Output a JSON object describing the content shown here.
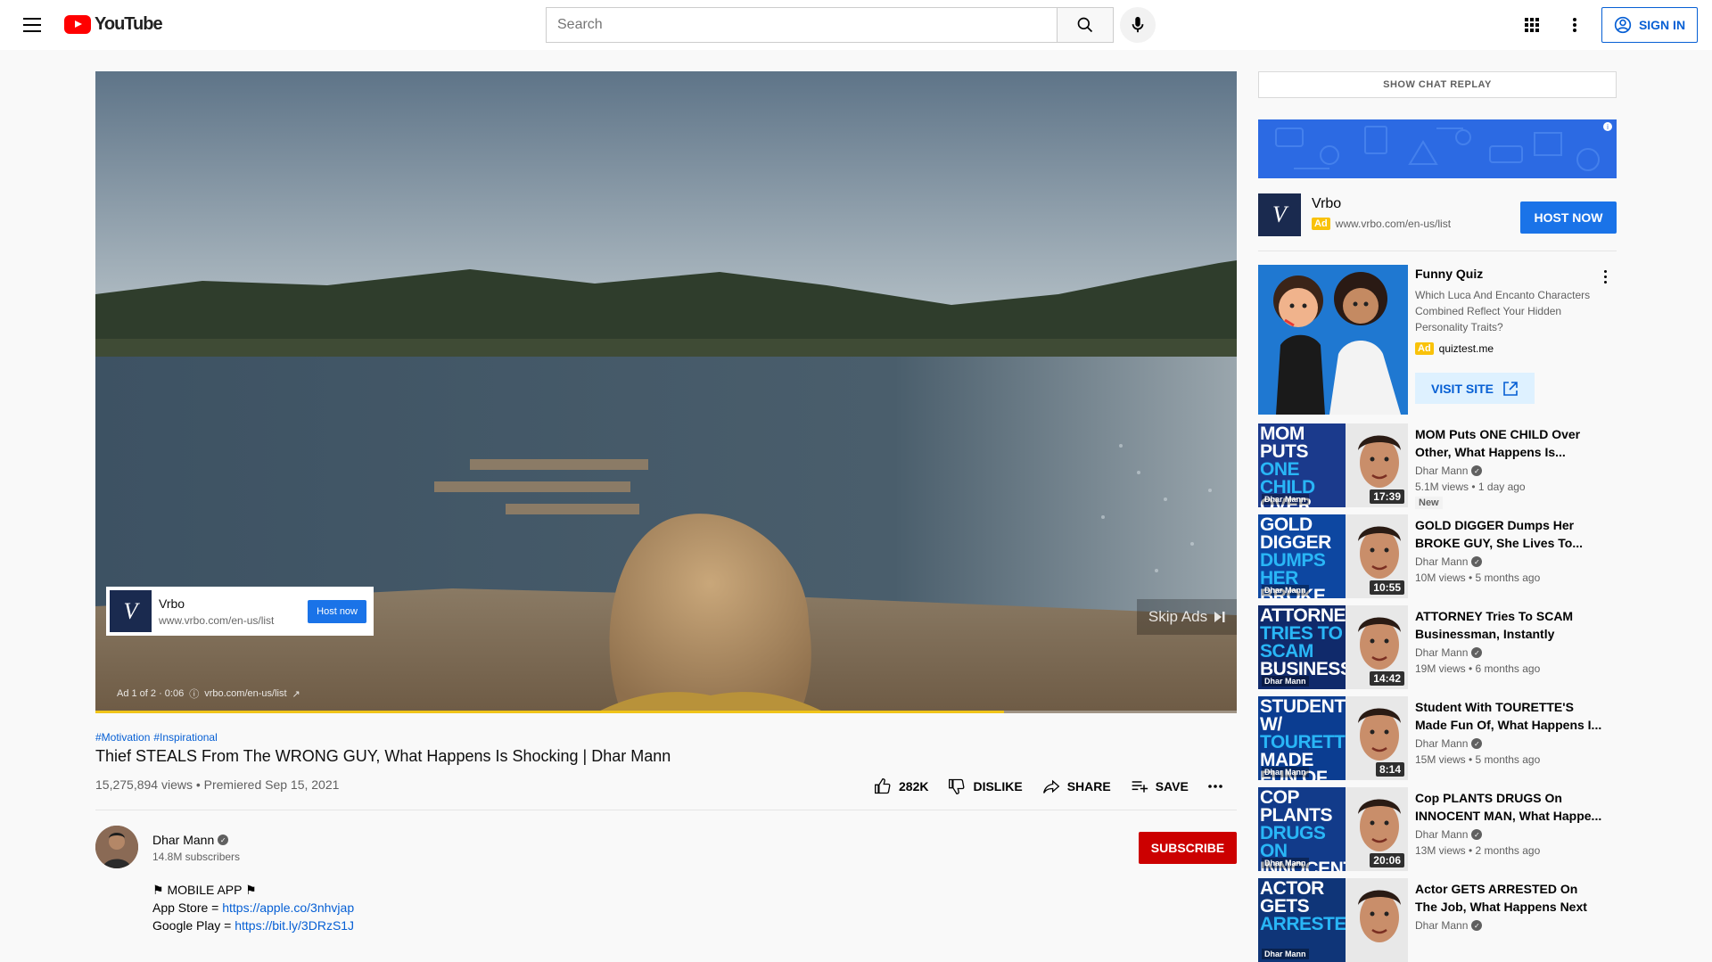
{
  "header": {
    "logo_text": "YouTube",
    "search_placeholder": "Search",
    "signin_label": "SIGN IN"
  },
  "player": {
    "progress": 0.796,
    "ad_card": {
      "name": "Vrbo",
      "url": "www.vrbo.com/en-us/list",
      "button": "Host now",
      "logo_letter": "V"
    },
    "skip_label": "Skip Ads",
    "ad_info": {
      "position": "Ad 1 of 2 · 0:06",
      "link": "vrbo.com/en-us/list"
    }
  },
  "video": {
    "tags": [
      "#Motivation",
      "#Inspirational"
    ],
    "title": "Thief STEALS From The WRONG GUY, What Happens Is Shocking | Dhar Mann",
    "views_line": "15,275,894 views • Premiered Sep 15, 2021",
    "likes": "282K",
    "dislike_label": "DISLIKE",
    "share_label": "SHARE",
    "save_label": "SAVE",
    "channel": {
      "name": "Dhar Mann",
      "subscribers": "14.8M subscribers"
    },
    "subscribe_label": "SUBSCRIBE",
    "description": {
      "line1": "⚑ MOBILE APP ⚑",
      "appstore_label": "App Store = ",
      "appstore_link": "https://apple.co/3nhvjap",
      "googleplay_label": "Google Play = ",
      "googleplay_link": "https://bit.ly/3DRzS1J"
    }
  },
  "sidebar": {
    "chat_replay_label": "SHOW CHAT REPLAY",
    "vrbo_ad": {
      "name": "Vrbo",
      "badge": "Ad",
      "url": "www.vrbo.com/en-us/list",
      "button": "HOST NOW",
      "logo_letter": "V"
    },
    "quiz_ad": {
      "title": "Funny Quiz",
      "description": "Which Luca And Encanto Characters Combined Reflect Your Hidden Personality Traits?",
      "badge": "Ad",
      "domain": "quiztest.me",
      "button": "VISIT SITE"
    },
    "recommendations": [
      {
        "thumb_lines": [
          "MOM PUTS",
          "ONE CHILD",
          "OVER OTHER"
        ],
        "thumb_color": "#1b3a8c",
        "accent": "#29b6f6",
        "brand": "Dhar Mann",
        "duration": "17:39",
        "title": "MOM Puts ONE CHILD Over Other, What Happens Is...",
        "channel": "Dhar Mann",
        "stats": "5.1M views • 1 day ago",
        "badge": "New"
      },
      {
        "thumb_lines": [
          "GOLD DIGGER",
          "DUMPS HER",
          "BROKE GUY"
        ],
        "thumb_color": "#0d47a1",
        "accent": "#29b6f6",
        "brand": "Dhar Mann",
        "duration": "10:55",
        "title": "GOLD DIGGER Dumps Her BROKE GUY, She Lives To...",
        "channel": "Dhar Mann",
        "stats": "10M views • 5 months ago"
      },
      {
        "thumb_lines": [
          "ATTORNEY",
          "TRIES TO SCAM",
          "BUSINESSMAN"
        ],
        "thumb_color": "#102a6b",
        "accent": "#29b6f6",
        "brand": "Dhar Mann",
        "duration": "14:42",
        "title": "ATTORNEY Tries To SCAM Businessman, Instantly Regret...",
        "channel": "Dhar Mann",
        "stats": "19M views • 6 months ago"
      },
      {
        "thumb_lines": [
          "STUDENT W/",
          "TOURETTE'S",
          "MADE FUN OF"
        ],
        "thumb_color": "#0b3d91",
        "accent": "#29b6f6",
        "brand": "Dhar Mann",
        "duration": "8:14",
        "title": "Student With TOURETTE'S Made Fun Of, What Happens I...",
        "channel": "Dhar Mann",
        "stats": "15M views • 5 months ago"
      },
      {
        "thumb_lines": [
          "COP PLANTS",
          "DRUGS ON",
          "INNOCENT MAN"
        ],
        "thumb_color": "#123b8a",
        "accent": "#29b6f6",
        "brand": "Dhar Mann",
        "duration": "20:06",
        "title": "Cop PLANTS DRUGS On INNOCENT MAN, What Happe...",
        "channel": "Dhar Mann",
        "stats": "13M views • 2 months ago"
      },
      {
        "thumb_lines": [
          "ACTOR GETS",
          "ARRESTED",
          ""
        ],
        "thumb_color": "#0f3578",
        "accent": "#29b6f6",
        "brand": "Dhar Mann",
        "duration": "",
        "title": "Actor GETS ARRESTED On The Job, What Happens Next Is...",
        "channel": "Dhar Mann",
        "stats": ""
      }
    ]
  },
  "colors": {
    "brand_red": "#ff0000",
    "link_blue": "#065fd4",
    "subscribe_red": "#cc0000",
    "progress_yellow": "#f0c419"
  }
}
